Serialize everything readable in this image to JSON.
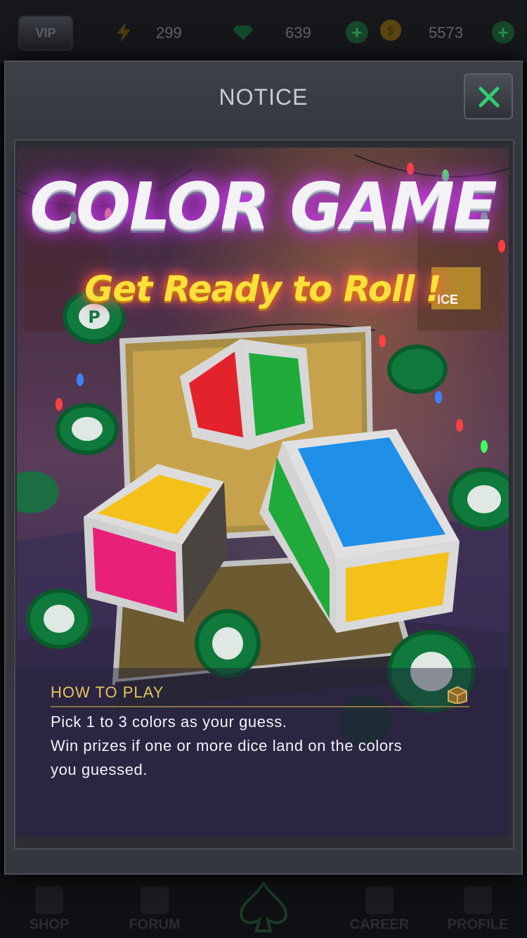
{
  "topbar": {
    "vip_label": "VIP",
    "energy_value": "299",
    "gems_value": "639",
    "coins_value": "5573",
    "plus_symbol": "+"
  },
  "bottomnav": {
    "items": [
      {
        "label": "SHOP"
      },
      {
        "label": "FORUM"
      },
      {
        "label": "CAREER"
      },
      {
        "label": "PROFILE"
      }
    ]
  },
  "modal": {
    "title": "NOTICE",
    "close_symbol": "✕"
  },
  "banner": {
    "headline": "COLOR GAME",
    "subhead": "Get Ready  to Roll !",
    "how_to_play_heading": "HOW TO PLAY",
    "description_lines": [
      "Pick 1 to 3 colors as your guess.",
      "Win prizes if one or more dice land on the colors",
      "you guessed."
    ],
    "chip_letter": "P",
    "stall_sign": "ICE"
  },
  "colors": {
    "accent_green": "#2fcf6e",
    "gold_text": "#e8c25f",
    "dice_red": "#e3222c",
    "dice_green": "#1faa3a",
    "dice_blue": "#1f8fe8",
    "dice_yellow": "#f4c01a",
    "dice_pink": "#e8207a",
    "chip_green": "#0f7a3c"
  },
  "icons": [
    "vip-badge-icon",
    "lightning-icon",
    "gem-icon",
    "coin-icon",
    "plus-icon",
    "close-icon",
    "shop-icon",
    "forum-icon",
    "spade-icon",
    "career-icon",
    "profile-icon",
    "treasure-box-icon",
    "poker-chip-icon"
  ]
}
